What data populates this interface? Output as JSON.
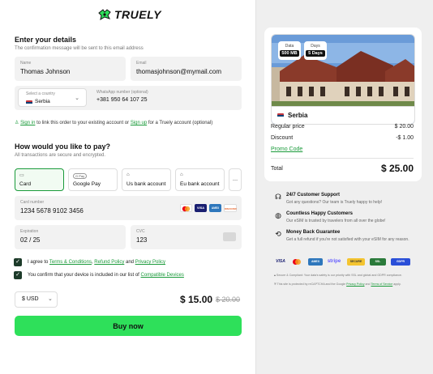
{
  "brand": {
    "name": "TRUELY"
  },
  "details": {
    "title": "Enter your details",
    "subtitle": "The confirmation message will be sent to this email address",
    "name": {
      "label": "Name",
      "value": "Thomas Johnson"
    },
    "email": {
      "label": "Email",
      "value": "thomasjohnson@mymail.com"
    },
    "country": {
      "label": "Select a country",
      "value": "Serbia"
    },
    "whatsapp": {
      "label": "WhatsApp number (optional)",
      "value": "+381 950 64 107 25"
    },
    "signin_note": {
      "signin": "Sign in",
      "middle": " to link this order to your existing account or ",
      "signup": "Sign up",
      "end": " for a Truely account (optional)"
    }
  },
  "payment": {
    "title": "How would you like to pay?",
    "subtitle": "All transactions are secure and encrypted.",
    "methods": [
      {
        "label": "Card",
        "icon": "card-icon"
      },
      {
        "label": "Google Pay",
        "icon": "gpay-icon",
        "icon_text": "G Pay"
      },
      {
        "label": "Us bank account",
        "icon": "bank-icon"
      },
      {
        "label": "Eu bank account",
        "icon": "bank-icon"
      }
    ],
    "more_label": "…",
    "card_number": {
      "label": "Card number",
      "value": "1234 5678 9102 3456"
    },
    "card_brands": [
      "mastercard",
      "VISA",
      "AMEX",
      "DISCOVER"
    ],
    "expiration": {
      "label": "Expiration",
      "value": "02 / 25"
    },
    "cvc": {
      "label": "CVC",
      "value": "123"
    }
  },
  "agreements": {
    "terms": {
      "prefix": "I agree to ",
      "terms": "Terms & Conditions",
      "sep1": ", ",
      "refund": "Refund Policy",
      "sep2": " and ",
      "privacy": "Privacy Policy"
    },
    "device": {
      "prefix": "You confirm that your device is included in our list of ",
      "link": "Compatible Devices"
    }
  },
  "checkout": {
    "currency": "$ USD",
    "price": "$ 15.00",
    "old_price": "$ 20.00",
    "buy_label": "Buy now"
  },
  "summary": {
    "data_label": "Data",
    "data_value": "500 MB",
    "days_label": "Days",
    "days_value": "5 Days",
    "destination": "Serbia",
    "regular_label": "Regular price",
    "regular_value": "$ 20.00",
    "discount_label": "Discount",
    "discount_value": "-$ 1.00",
    "promo_label": "Promo Code",
    "total_label": "Total",
    "total_value": "$ 25.00"
  },
  "features": [
    {
      "icon": "headset-icon",
      "title": "24/7 Customer Support",
      "desc": "Got any questions? Our team is Truely happy to help!"
    },
    {
      "icon": "globe-icon",
      "title": "Countless Happy Customers",
      "desc": "Our eSIM is trusted by travelers from all over the globe!"
    },
    {
      "icon": "money-back-icon",
      "title": "Money Back Guarantee",
      "desc": "Get a full refund if you're not satisfied with your eSIM for any reason."
    }
  ],
  "payment_logos": [
    "VISA",
    "mastercard",
    "AMEX",
    "stripe",
    "SECURE",
    "SSL",
    "GDPR"
  ],
  "secure_notes": {
    "line1": "Secure & Compliant: Your data's safety is our priority with SSL and global and GDPR compliance.",
    "line2_prefix": "This site is protected by reCAPTCHA and the Google ",
    "privacy": "Privacy Policy",
    "line2_mid": " and ",
    "terms": "Terms of Service",
    "line2_end": " apply."
  },
  "colors": {
    "accent": "#2ee05a",
    "link": "#1a9a3a",
    "dark_check": "#1d3b2a"
  }
}
